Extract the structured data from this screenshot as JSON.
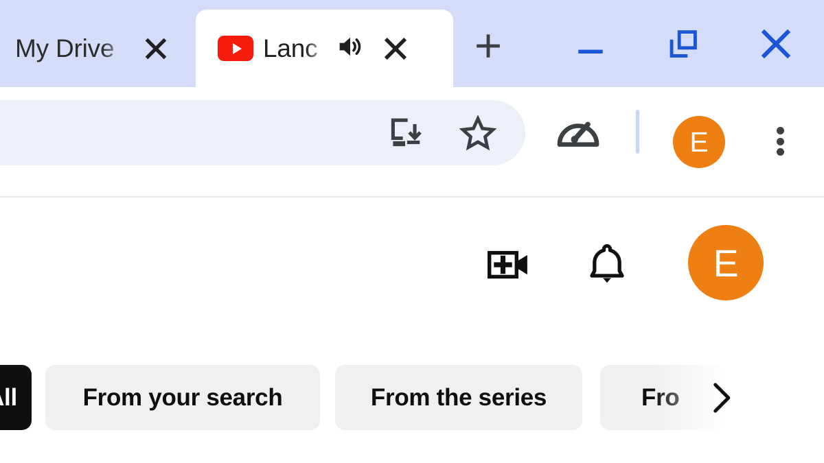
{
  "browser": {
    "tabs": [
      {
        "title": "My Drive",
        "favicon": "none",
        "active": false,
        "audio_playing": false,
        "close_icon": "close-icon"
      },
      {
        "title": "Lanc",
        "favicon": "youtube-favicon",
        "active": true,
        "audio_playing": true,
        "audio_icon": "speaker-volume-icon",
        "close_icon": "close-icon"
      }
    ],
    "new_tab_icon": "plus-icon",
    "window_controls": {
      "minimize_icon": "minimize-icon",
      "restore_icon": "restore-window-icon",
      "close_icon": "close-window-icon",
      "control_color": "#1a56d6"
    },
    "toolbar": {
      "omnibox_value": "",
      "omnibox_placeholder": "",
      "install_icon": "install-app-icon",
      "bookmark_icon": "star-outline-icon",
      "performance_icon": "speedometer-icon",
      "menu_icon": "three-dot-menu-icon",
      "avatar_initial": "E",
      "avatar_color": "#ee7f12"
    },
    "tabstrip_color": "#d4dcf7",
    "omnibox_color": "#edf0f8"
  },
  "youtube": {
    "masthead": {
      "create_icon": "create-video-icon",
      "notifications_icon": "bell-icon",
      "avatar_initial": "E",
      "avatar_color": "#ee7f12"
    },
    "chips": [
      {
        "label": "All",
        "selected": true
      },
      {
        "label": "From your search",
        "selected": false
      },
      {
        "label": "From the series",
        "selected": false
      },
      {
        "label": "Fro",
        "selected": false
      }
    ],
    "chip_scroll_icon": "chevron-right-icon",
    "chip_selected_color": "#0f0f0f",
    "chip_unselected_color": "#f0f0f0"
  }
}
